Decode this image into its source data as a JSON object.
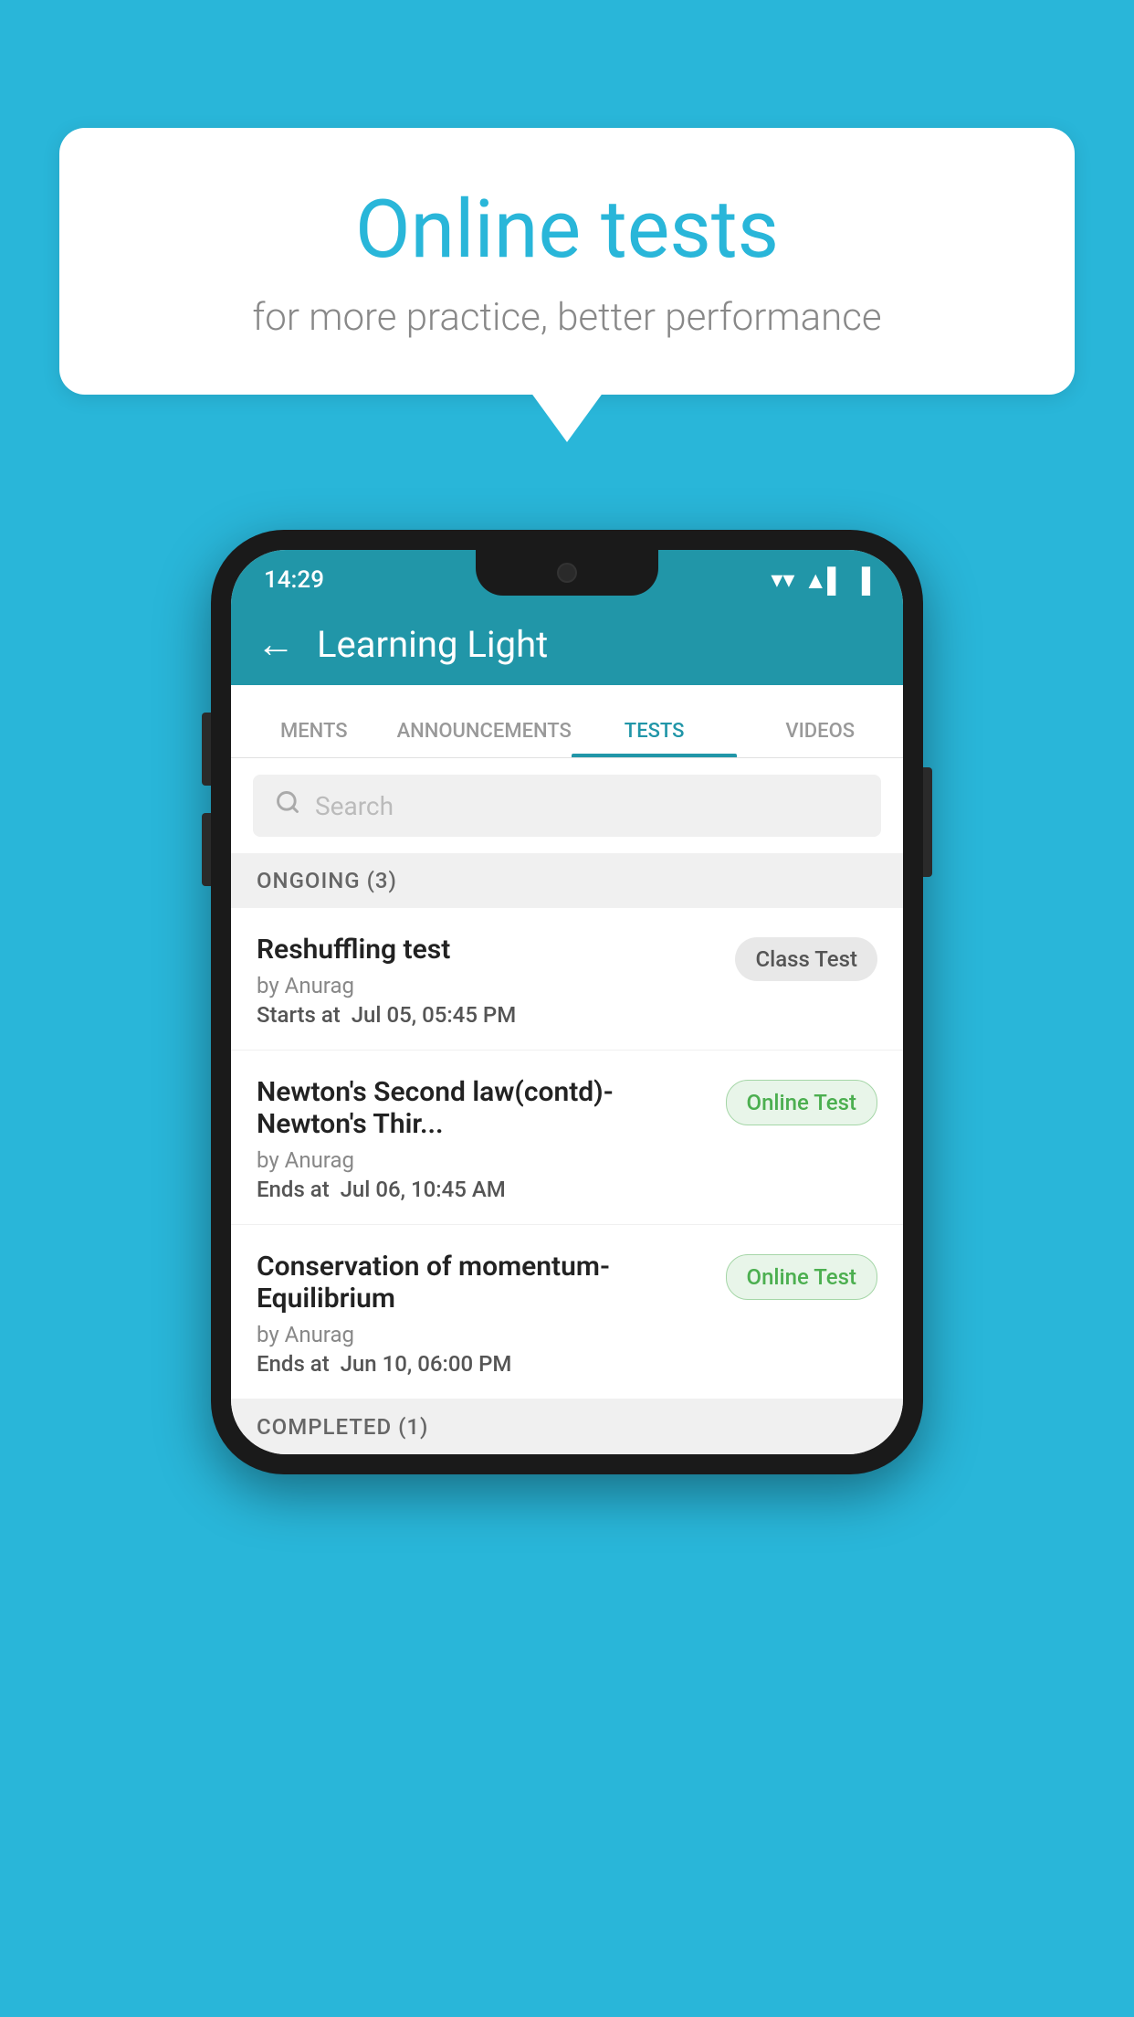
{
  "background": {
    "color": "#29B6D9"
  },
  "speech_bubble": {
    "title": "Online tests",
    "subtitle": "for more practice, better performance"
  },
  "phone": {
    "status_bar": {
      "time": "14:29",
      "wifi": "▼",
      "signal": "▲",
      "battery": "▌"
    },
    "app_bar": {
      "back_label": "←",
      "title": "Learning Light"
    },
    "tabs": [
      {
        "label": "MENTS",
        "active": false
      },
      {
        "label": "ANNOUNCEMENTS",
        "active": false
      },
      {
        "label": "TESTS",
        "active": true
      },
      {
        "label": "VIDEOS",
        "active": false
      }
    ],
    "search": {
      "placeholder": "Search"
    },
    "ongoing_section": {
      "label": "ONGOING (3)"
    },
    "tests": [
      {
        "name": "Reshuffling test",
        "by": "by Anurag",
        "time_label": "Starts at",
        "time_value": "Jul 05, 05:45 PM",
        "badge": "Class Test",
        "badge_type": "class"
      },
      {
        "name": "Newton's Second law(contd)-Newton's Thir...",
        "by": "by Anurag",
        "time_label": "Ends at",
        "time_value": "Jul 06, 10:45 AM",
        "badge": "Online Test",
        "badge_type": "online"
      },
      {
        "name": "Conservation of momentum-Equilibrium",
        "by": "by Anurag",
        "time_label": "Ends at",
        "time_value": "Jun 10, 06:00 PM",
        "badge": "Online Test",
        "badge_type": "online"
      }
    ],
    "completed_section": {
      "label": "COMPLETED (1)"
    }
  }
}
